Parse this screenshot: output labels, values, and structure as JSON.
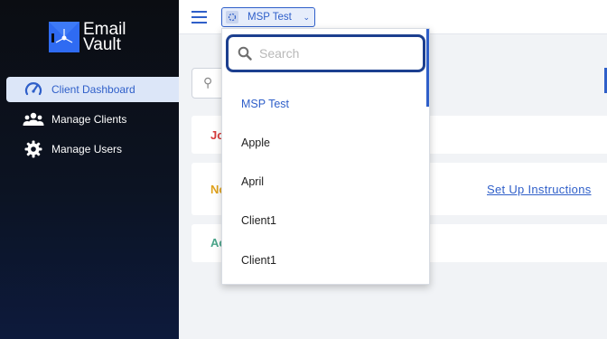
{
  "logo": {
    "line1": "Email",
    "line2": "Vault"
  },
  "sidebar": {
    "items": [
      {
        "label": "Client Dashboard",
        "icon": "speedometer-icon",
        "active": true
      },
      {
        "label": "Manage Clients",
        "icon": "users-group-icon",
        "active": false
      },
      {
        "label": "Manage Users",
        "icon": "gear-icon",
        "active": false
      }
    ]
  },
  "header": {
    "org_selector": {
      "value": "MSP Test",
      "icon": "org-icon"
    }
  },
  "dropdown": {
    "search_placeholder": "Search",
    "options": [
      "MSP Test",
      "Apple",
      "April",
      "Client1",
      "Client1"
    ],
    "selected_index": 0
  },
  "cards": {
    "card1_prefix": "Jo",
    "card2_prefix": "No",
    "card2_link": "Set Up Instructions",
    "card3_prefix": "Ac"
  },
  "colors": {
    "accent": "#2f5fc9",
    "brand": "#2f6bf2",
    "card1_text": "#d63a3a",
    "card2_text": "#e0a21c",
    "card3_text": "#4aa58a"
  }
}
